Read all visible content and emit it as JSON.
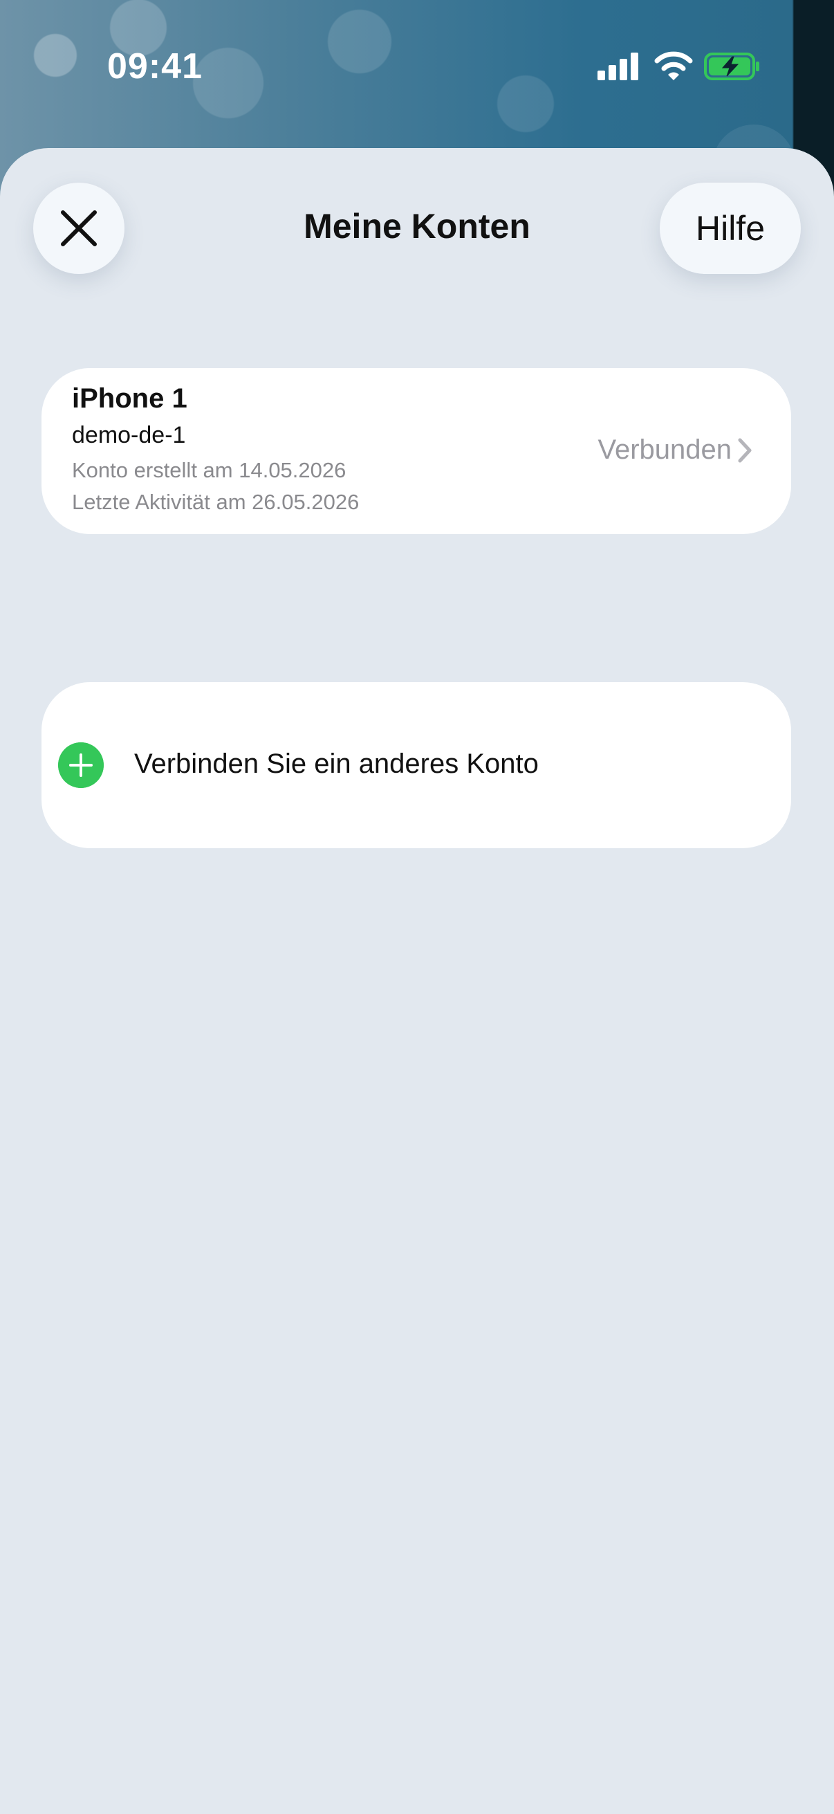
{
  "status_bar": {
    "time": "09:41",
    "icons": [
      "cellular-signal-icon",
      "wifi-icon",
      "battery-charging-icon"
    ]
  },
  "header": {
    "title": "Meine Konten",
    "close_icon": "close-icon",
    "help_label": "Hilfe"
  },
  "account": {
    "device_name": "iPhone 1",
    "account_id": "demo-de-1",
    "created": "Konto erstellt am 14.05.2026",
    "last_activity": "Letzte Aktivität am 26.05.2026",
    "status": "Verbunden"
  },
  "connect": {
    "label": "Verbinden Sie ein anderes Konto",
    "icon": "plus-icon"
  },
  "colors": {
    "sheet_background": "#e2e8ef",
    "card_background": "#ffffff",
    "accent_green": "#34c759",
    "secondary_text": "#8a8a8e",
    "battery_fill": "#34c759"
  }
}
